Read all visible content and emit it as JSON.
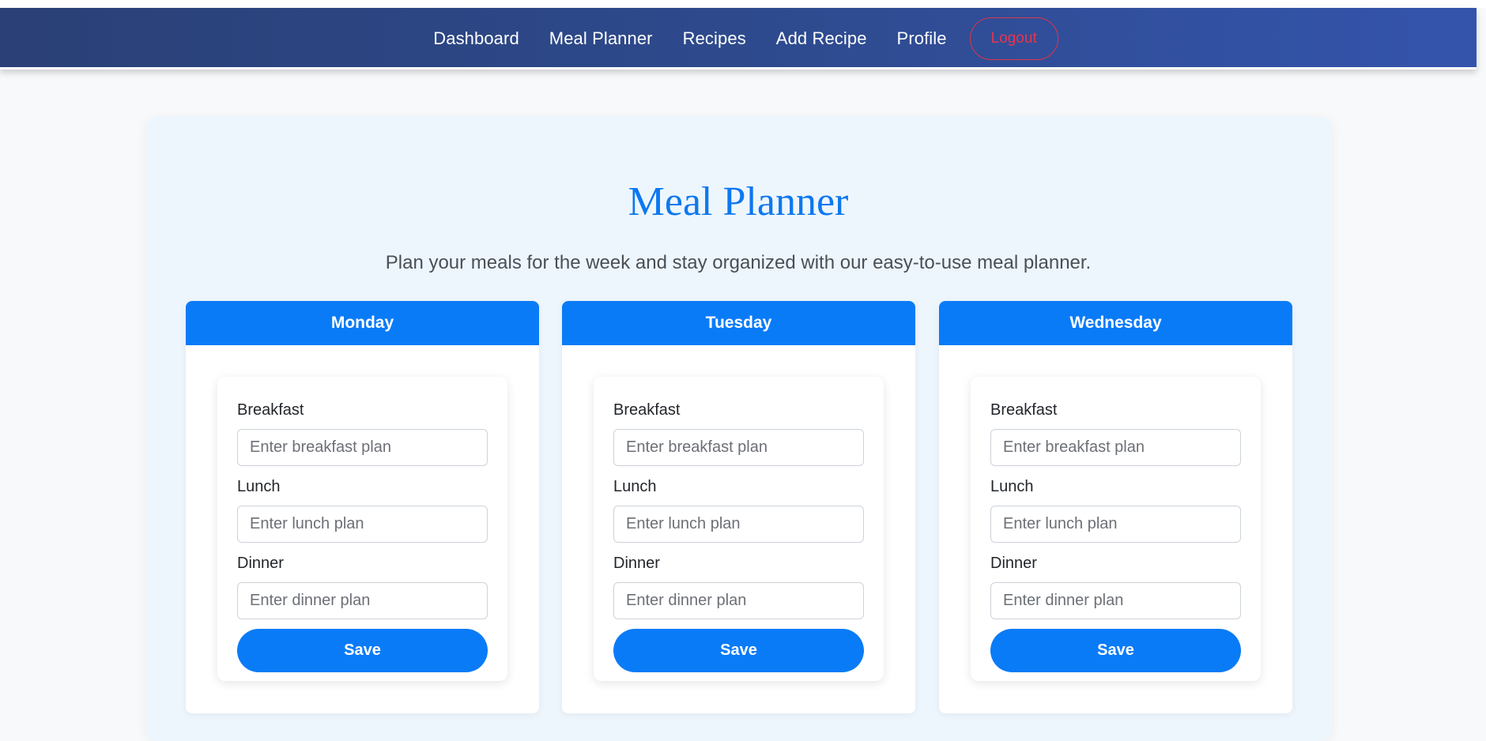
{
  "nav": {
    "links": [
      "Dashboard",
      "Meal Planner",
      "Recipes",
      "Add Recipe",
      "Profile"
    ],
    "logout_label": "Logout"
  },
  "page": {
    "title": "Meal Planner",
    "subtitle": "Plan your meals for the week and stay organized with our easy-to-use meal planner."
  },
  "days": [
    {
      "name": "Monday",
      "breakfast_label": "Breakfast",
      "breakfast_placeholder": "Enter breakfast plan",
      "breakfast_value": "",
      "lunch_label": "Lunch",
      "lunch_placeholder": "Enter lunch plan",
      "lunch_value": "",
      "dinner_label": "Dinner",
      "dinner_placeholder": "Enter dinner plan",
      "dinner_value": "",
      "save_label": "Save"
    },
    {
      "name": "Tuesday",
      "breakfast_label": "Breakfast",
      "breakfast_placeholder": "Enter breakfast plan",
      "breakfast_value": "",
      "lunch_label": "Lunch",
      "lunch_placeholder": "Enter lunch plan",
      "lunch_value": "",
      "dinner_label": "Dinner",
      "dinner_placeholder": "Enter dinner plan",
      "dinner_value": "",
      "save_label": "Save"
    },
    {
      "name": "Wednesday",
      "breakfast_label": "Breakfast",
      "breakfast_placeholder": "Enter breakfast plan",
      "breakfast_value": "",
      "lunch_label": "Lunch",
      "lunch_placeholder": "Enter lunch plan",
      "lunch_value": "",
      "dinner_label": "Dinner",
      "dinner_placeholder": "Enter dinner plan",
      "dinner_value": "",
      "save_label": "Save"
    }
  ],
  "colors": {
    "nav_gradient_start": "#2a4076",
    "nav_gradient_end": "#3454ac",
    "accent": "#0a7bf7",
    "title": "#0d78f0",
    "logout": "#dc3545",
    "card_bg": "#eef6fd"
  }
}
